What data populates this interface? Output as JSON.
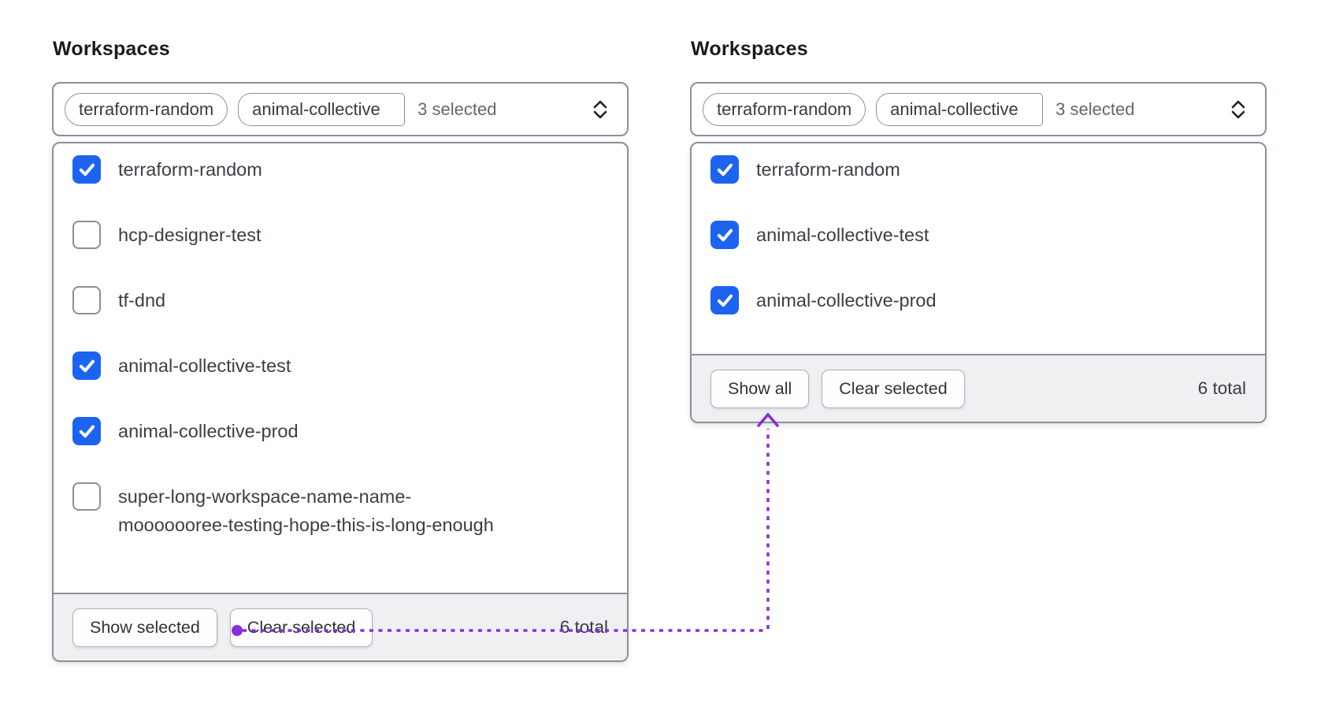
{
  "colors": {
    "checkbox_blue": "#1c64f0",
    "annotation_purple": "#8a2be2",
    "border_gray": "#8b8f9a",
    "footer_bg": "#f0f0f3"
  },
  "icons": {
    "select_caret": "chevron-up-down",
    "checkmark": "check",
    "annotation_start": "dot",
    "annotation_end": "arrow-up"
  },
  "panels": [
    {
      "title": "Workspaces",
      "select": {
        "tags": [
          "terraform-random",
          "animal-collective"
        ],
        "summary": "3 selected"
      },
      "options": [
        {
          "label": "terraform-random",
          "checked": true
        },
        {
          "label": "hcp-designer-test",
          "checked": false
        },
        {
          "label": "tf-dnd",
          "checked": false
        },
        {
          "label": "animal-collective-test",
          "checked": true
        },
        {
          "label": "animal-collective-prod",
          "checked": true
        },
        {
          "label": [
            "super-long-workspace-name-name-",
            "mooooooree-testing-hope-this-is-long-enough"
          ],
          "checked": false
        }
      ],
      "footer": {
        "show_button": "Show selected",
        "clear_button": "Clear selected",
        "total": "6 total"
      }
    },
    {
      "title": "Workspaces",
      "select": {
        "tags": [
          "terraform-random",
          "animal-collective"
        ],
        "summary": "3 selected"
      },
      "options": [
        {
          "label": "terraform-random",
          "checked": true
        },
        {
          "label": "animal-collective-test",
          "checked": true
        },
        {
          "label": "animal-collective-prod",
          "checked": true
        }
      ],
      "footer": {
        "show_button": "Show all",
        "clear_button": "Clear selected",
        "total": "6 total"
      }
    }
  ]
}
